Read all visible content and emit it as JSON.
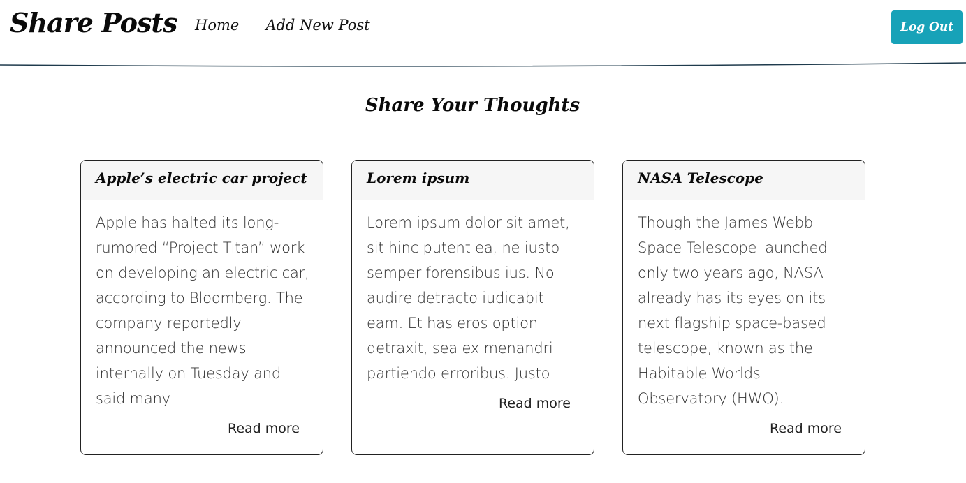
{
  "navbar": {
    "brand": "Share Posts",
    "links": [
      {
        "label": "Home"
      },
      {
        "label": "Add New Post"
      }
    ],
    "logout_label": "Log Out",
    "logout_color": "#17a2b8"
  },
  "main": {
    "title": "Share Your Thoughts",
    "posts": [
      {
        "title": "Apple’s electric car project",
        "excerpt": "Apple has halted its long-rumored “Project Titan” work on developing an electric car, according to Bloomberg. The company reportedly announced the news internally on Tuesday and said many",
        "read_more": "Read more"
      },
      {
        "title": "Lorem ipsum",
        "excerpt": "Lorem ipsum dolor sit amet, sit hinc putent ea, ne iusto semper forensibus ius. No audire detracto iudicabit eam. Et has eros option detraxit, sea ex menandri partiendo erroribus. Justo",
        "read_more": "Read more"
      },
      {
        "title": "NASA Telescope",
        "excerpt": "Though the James Webb Space Telescope launched only two years ago, NASA already has its eyes on its next flagship space-based telescope, known as the Habitable Worlds Observatory (HWO).",
        "read_more": "Read more"
      }
    ]
  }
}
